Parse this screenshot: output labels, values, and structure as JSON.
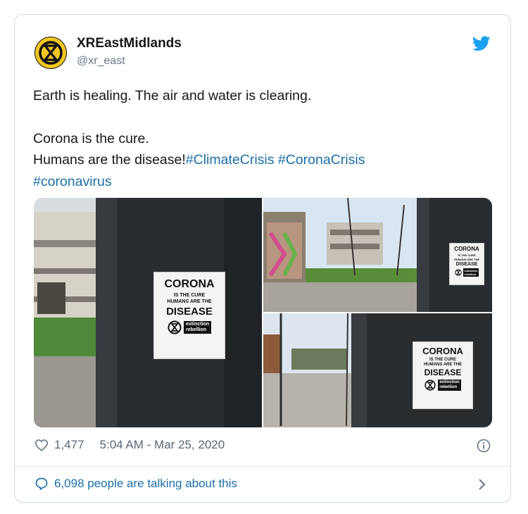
{
  "author": {
    "name": "XREastMidlands",
    "handle": "@xr_east"
  },
  "tweet": {
    "line1": "Earth is healing. The air and water is clearing.",
    "line2": "Corona is the cure.",
    "line3": "Humans are the disease!",
    "hashtags": [
      "#ClimateCrisis",
      "#CoronaCrisis",
      "#coronavirus"
    ]
  },
  "poster": {
    "title": "CORONA",
    "line1": "IS THE CURE",
    "line2": "HUMANS ARE THE",
    "line3": "DISEASE",
    "brand1": "extinction",
    "brand2": "rebellion"
  },
  "meta": {
    "likes": "1,477",
    "timestamp": "5:04 AM - Mar 25, 2020"
  },
  "footer": {
    "talking": "6,098 people are talking about this"
  },
  "colors": {
    "link": "#1b6ea8",
    "twitter_blue": "#1da1f2",
    "xr_yellow": "#f3c623"
  }
}
